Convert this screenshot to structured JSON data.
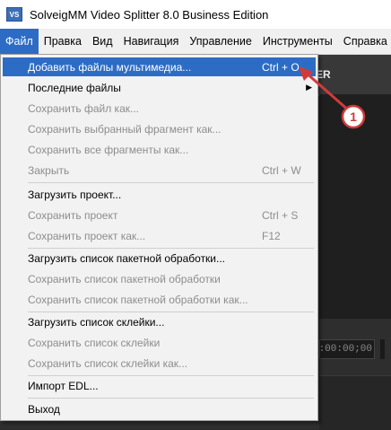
{
  "window": {
    "icon_text": "VS",
    "title": "SolveigMM Video Splitter 8.0 Business Edition"
  },
  "menubar": [
    {
      "label": "Файл",
      "active": true
    },
    {
      "label": "Правка"
    },
    {
      "label": "Вид"
    },
    {
      "label": "Навигация"
    },
    {
      "label": "Управление"
    },
    {
      "label": "Инструменты"
    },
    {
      "label": "Справка"
    }
  ],
  "file_menu": {
    "items": [
      {
        "label": "Добавить файлы мультимедиа...",
        "shortcut": "Ctrl + O",
        "state": "highlighted"
      },
      {
        "label": "Последние файлы",
        "shortcut": "",
        "state": "enabled",
        "submenu": true
      },
      {
        "label": "Сохранить файл как...",
        "shortcut": "",
        "state": "disabled"
      },
      {
        "label": "Сохранить выбранный фрагмент как...",
        "shortcut": "",
        "state": "disabled"
      },
      {
        "label": "Сохранить все фрагменты как...",
        "shortcut": "",
        "state": "disabled"
      },
      {
        "label": "Закрыть",
        "shortcut": "Ctrl + W",
        "state": "disabled"
      },
      {
        "separator": true
      },
      {
        "label": "Загрузить проект...",
        "shortcut": "",
        "state": "enabled"
      },
      {
        "label": "Сохранить проект",
        "shortcut": "Ctrl + S",
        "state": "disabled"
      },
      {
        "label": "Сохранить проект как...",
        "shortcut": "F12",
        "state": "disabled"
      },
      {
        "separator": true
      },
      {
        "label": "Загрузить список пакетной обработки...",
        "shortcut": "",
        "state": "enabled"
      },
      {
        "label": "Сохранить список пакетной обработки",
        "shortcut": "",
        "state": "disabled"
      },
      {
        "label": "Сохранить список пакетной обработки как...",
        "shortcut": "",
        "state": "disabled"
      },
      {
        "separator": true
      },
      {
        "label": "Загрузить список склейки...",
        "shortcut": "",
        "state": "enabled"
      },
      {
        "label": "Сохранить список склейки",
        "shortcut": "",
        "state": "disabled"
      },
      {
        "label": "Сохранить список склейки как...",
        "shortcut": "",
        "state": "disabled"
      },
      {
        "separator": true
      },
      {
        "label": "Импорт EDL...",
        "shortcut": "",
        "state": "enabled"
      },
      {
        "separator": true
      },
      {
        "label": "Выход",
        "shortcut": "",
        "state": "enabled"
      }
    ]
  },
  "background": {
    "tab_fragment": "ER",
    "timecode_fragment": "):00:00;00"
  },
  "annotation": {
    "number": "1",
    "color": "#d23a3a"
  }
}
